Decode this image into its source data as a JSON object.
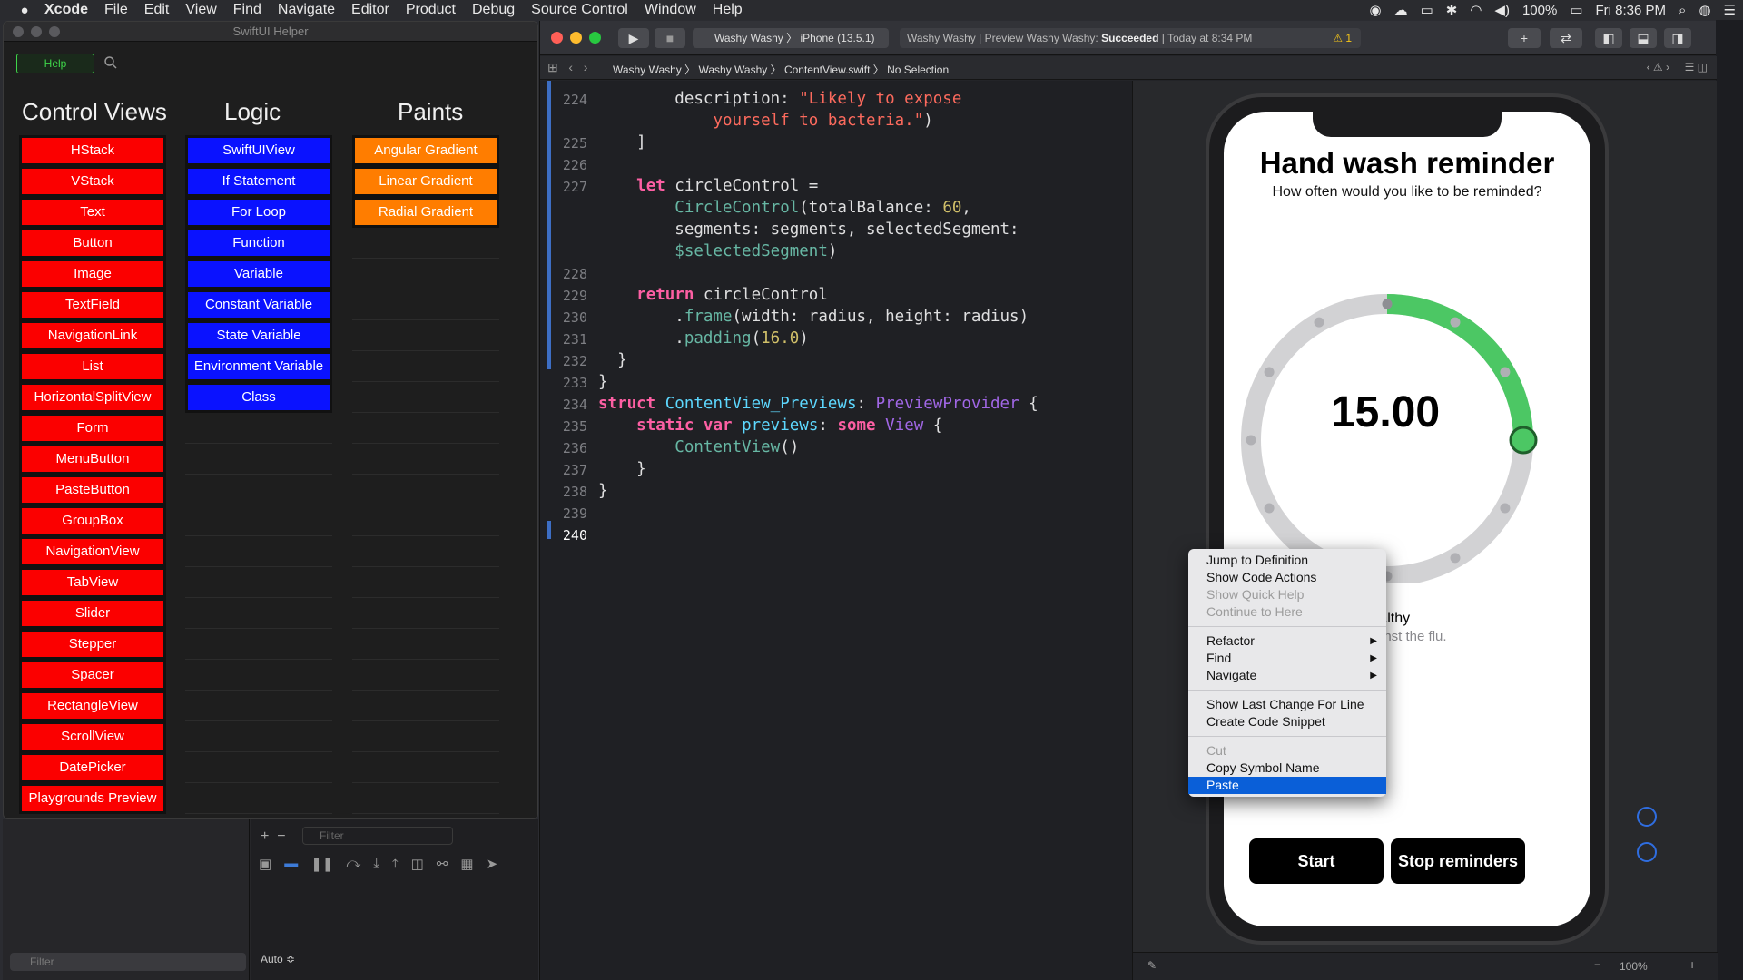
{
  "menubar": {
    "apple": "",
    "app": "Xcode",
    "items": [
      "File",
      "Edit",
      "View",
      "Find",
      "Navigate",
      "Editor",
      "Product",
      "Debug",
      "Source Control",
      "Window",
      "Help"
    ],
    "battery": "100%",
    "clock": "Fri 8:36 PM"
  },
  "helper": {
    "title": "SwiftUI Helper",
    "help_label": "Help",
    "columns": [
      {
        "title": "Control Views",
        "color": "#fb0000",
        "items": [
          "HStack",
          "VStack",
          "Text",
          "Button",
          "Image",
          "TextField",
          "NavigationLink",
          "List",
          "HorizontalSplitView",
          "Form",
          "MenuButton",
          "PasteButton",
          "GroupBox",
          "NavigationView",
          "TabView",
          "Slider",
          "Stepper",
          "Spacer",
          "RectangleView",
          "ScrollView",
          "DatePicker",
          "Playgrounds Preview"
        ]
      },
      {
        "title": "Logic",
        "color": "#0a12ff",
        "items": [
          "SwiftUIView",
          "If Statement",
          "For Loop",
          "Function",
          "Variable",
          "Constant Variable",
          "State Variable",
          "Environment Variable",
          "Class"
        ]
      },
      {
        "title": "Paints",
        "color": "#ff7d00",
        "items": [
          "Angular Gradient",
          "Linear Gradient",
          "Radial Gradient"
        ]
      }
    ]
  },
  "debug": {
    "filter_placeholder": "Filter",
    "auto_label": "Auto ≎"
  },
  "xcode": {
    "scheme": "Washy Washy 〉 iPhone (13.5.1)",
    "activity_prefix": "Washy Washy | Preview Washy Washy: ",
    "activity_status": "Succeeded",
    "activity_time": " | Today at 8:34 PM",
    "warning_count": "⚠ 1",
    "breadcrumb": [
      "Washy Washy",
      "Washy Washy",
      "ContentView.swift",
      "No Selection"
    ]
  },
  "code_lines": [
    {
      "n": "224",
      "html": "        description: <span class='str'>\"Likely to expose</span>"
    },
    {
      "n": "",
      "html": "            <span class='str'>yourself to bacteria.\"</span>)"
    },
    {
      "n": "225",
      "html": "    ]"
    },
    {
      "n": "226",
      "html": ""
    },
    {
      "n": "227",
      "html": "    <span class='kw'>let</span> circleControl ="
    },
    {
      "n": "",
      "html": "        <span class='fn'>CircleControl</span>(totalBalance: <span class='num'>60</span>,"
    },
    {
      "n": "",
      "html": "        segments: segments, selectedSegment:"
    },
    {
      "n": "",
      "html": "        <span class='fn'>$selectedSegment</span>)"
    },
    {
      "n": "228",
      "html": ""
    },
    {
      "n": "229",
      "html": "    <span class='kw'>return</span> circleControl"
    },
    {
      "n": "230",
      "html": "        .<span class='fn'>frame</span>(width: radius, height: radius)"
    },
    {
      "n": "231",
      "html": "        .<span class='fn'>padding</span>(<span class='num'>16.0</span>)"
    },
    {
      "n": "232",
      "html": "  }"
    },
    {
      "n": "233",
      "html": "}"
    },
    {
      "n": "234",
      "html": "<span class='kw'>struct</span> <span class='ty'>ContentView_Previews</span>: <span class='pl'>PreviewProvider</span> {"
    },
    {
      "n": "235",
      "html": "    <span class='kw'>static var</span> <span class='ty'>previews</span>: <span class='kw'>some</span> <span class='pl'>View</span> {"
    },
    {
      "n": "236",
      "html": "        <span class='fn'>ContentView</span>()"
    },
    {
      "n": "237",
      "html": "    }"
    },
    {
      "n": "238",
      "html": "}"
    },
    {
      "n": "239",
      "html": ""
    },
    {
      "n": "240",
      "html": ""
    }
  ],
  "context_menu": [
    {
      "label": "Jump to Definition",
      "state": "normal"
    },
    {
      "label": "Show Code Actions",
      "state": "normal"
    },
    {
      "label": "Show Quick Help",
      "state": "disabled"
    },
    {
      "label": "Continue to Here",
      "state": "disabled"
    },
    {
      "sep": true
    },
    {
      "label": "Refactor",
      "state": "normal",
      "submenu": true
    },
    {
      "label": "Find",
      "state": "normal",
      "submenu": true
    },
    {
      "label": "Navigate",
      "state": "normal",
      "submenu": true
    },
    {
      "sep": true
    },
    {
      "label": "Show Last Change For Line",
      "state": "normal"
    },
    {
      "label": "Create Code Snippet",
      "state": "normal"
    },
    {
      "sep": true
    },
    {
      "label": "Cut",
      "state": "disabled"
    },
    {
      "label": "Copy Symbol Name",
      "state": "normal"
    },
    {
      "label": "Paste",
      "state": "selected"
    }
  ],
  "preview": {
    "title": "Hand wash reminder",
    "subtitle": "How often would you like to be reminded?",
    "dial_value": "15.00",
    "dial_progress_fraction": 0.25,
    "segment_count": 12,
    "accent": "#4cc764",
    "segment_title": "Healthy",
    "segment_description": "Fight against the flu.",
    "start_label": "Start",
    "stop_label": "Stop reminders",
    "zoom": "100%"
  }
}
